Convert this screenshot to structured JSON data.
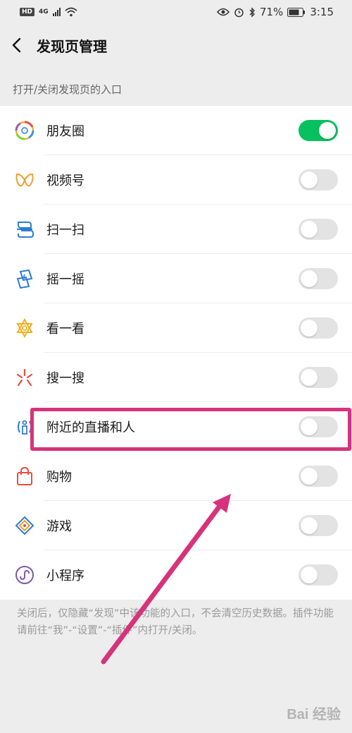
{
  "status_bar": {
    "hd": "HD",
    "network": "4G",
    "battery": "71%",
    "time": "3:15"
  },
  "header": {
    "title": "发现页管理"
  },
  "section_label": "打开/关闭发现页的入口",
  "items": [
    {
      "label": "朋友圈",
      "icon": "moments-icon",
      "enabled": true
    },
    {
      "label": "视频号",
      "icon": "channels-icon",
      "enabled": false
    },
    {
      "label": "扫一扫",
      "icon": "scan-icon",
      "enabled": false
    },
    {
      "label": "摇一摇",
      "icon": "shake-icon",
      "enabled": false
    },
    {
      "label": "看一看",
      "icon": "top-stories-icon",
      "enabled": false
    },
    {
      "label": "搜一搜",
      "icon": "search-icon",
      "enabled": false
    },
    {
      "label": "附近的直播和人",
      "icon": "nearby-icon",
      "enabled": false
    },
    {
      "label": "购物",
      "icon": "shopping-bag-icon",
      "enabled": false
    },
    {
      "label": "游戏",
      "icon": "games-icon",
      "enabled": false
    },
    {
      "label": "小程序",
      "icon": "mini-programs-icon",
      "enabled": false
    }
  ],
  "footer_note": "关闭后，仅隐藏“发现”中该功能的入口，不会清空历史数据。插件功能请前往“我”-“设置”-“插件”内打开/关闭。",
  "watermark": "Bai 经验",
  "colors": {
    "toggle_on": "#07c160",
    "toggle_off": "#e3e3e3",
    "annotation": "#d6337a"
  }
}
